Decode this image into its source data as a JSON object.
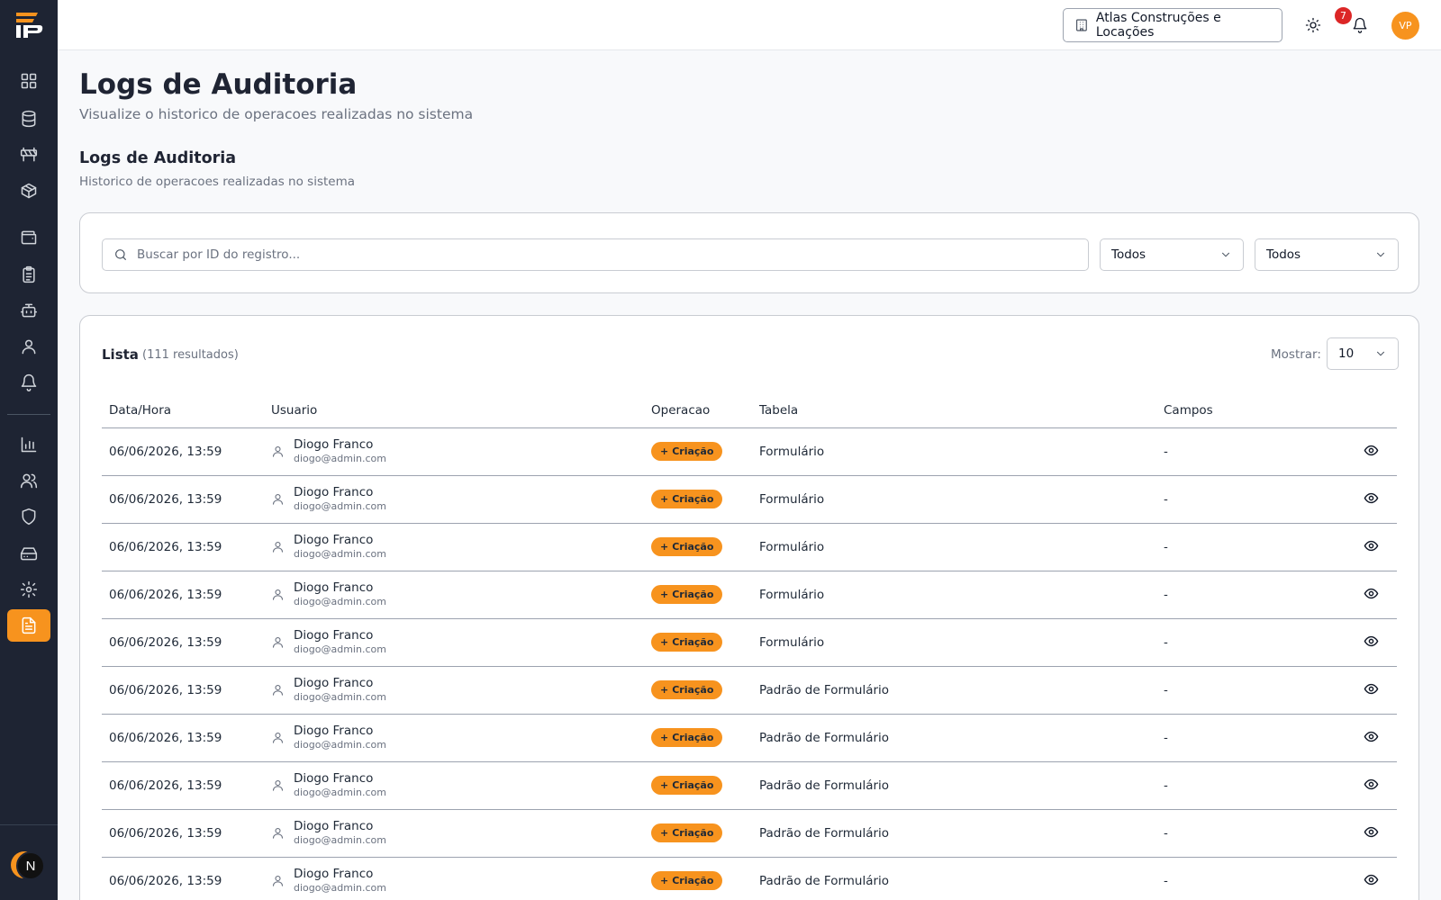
{
  "header": {
    "company": "Atlas Construções e Locações",
    "notifications_count": "7",
    "avatar_initials": "VP"
  },
  "sidebar": {
    "items": [
      {
        "icon": "dashboard-icon"
      },
      {
        "icon": "database-icon"
      },
      {
        "icon": "barrier-icon"
      },
      {
        "icon": "box-icon"
      },
      {
        "icon": "wallet-icon"
      },
      {
        "icon": "clipboard-icon"
      },
      {
        "icon": "bot-icon"
      },
      {
        "icon": "user-icon"
      },
      {
        "icon": "bell-icon"
      },
      {
        "icon": "chart-icon"
      },
      {
        "icon": "users-icon"
      },
      {
        "icon": "shield-icon"
      },
      {
        "icon": "drive-icon"
      },
      {
        "icon": "settings-icon"
      },
      {
        "icon": "file-text-icon",
        "active": true
      }
    ],
    "bottom_badge": "N",
    "active_color": "#f7931e"
  },
  "page": {
    "title": "Logs de Auditoria",
    "subtitle": "Visualize o historico de operacoes realizadas no sistema",
    "section_title": "Logs de Auditoria",
    "section_subtitle": "Historico de operacoes realizadas no sistema"
  },
  "filters": {
    "search_placeholder": "Buscar por ID do registro...",
    "select1": "Todos",
    "select2": "Todos"
  },
  "list": {
    "title": "Lista",
    "count": "(111 resultados)",
    "show_label": "Mostrar:",
    "page_size": "10",
    "columns": [
      "Data/Hora",
      "Usuario",
      "Operacao",
      "Tabela",
      "Campos"
    ],
    "rows": [
      {
        "datetime": "06/06/2026, 13:59",
        "user": "Diogo Franco",
        "email": "diogo@admin.com",
        "operation": "Criação",
        "table": "Formulário",
        "fields": "-"
      },
      {
        "datetime": "06/06/2026, 13:59",
        "user": "Diogo Franco",
        "email": "diogo@admin.com",
        "operation": "Criação",
        "table": "Formulário",
        "fields": "-"
      },
      {
        "datetime": "06/06/2026, 13:59",
        "user": "Diogo Franco",
        "email": "diogo@admin.com",
        "operation": "Criação",
        "table": "Formulário",
        "fields": "-"
      },
      {
        "datetime": "06/06/2026, 13:59",
        "user": "Diogo Franco",
        "email": "diogo@admin.com",
        "operation": "Criação",
        "table": "Formulário",
        "fields": "-"
      },
      {
        "datetime": "06/06/2026, 13:59",
        "user": "Diogo Franco",
        "email": "diogo@admin.com",
        "operation": "Criação",
        "table": "Formulário",
        "fields": "-"
      },
      {
        "datetime": "06/06/2026, 13:59",
        "user": "Diogo Franco",
        "email": "diogo@admin.com",
        "operation": "Criação",
        "table": "Padrão de Formulário",
        "fields": "-"
      },
      {
        "datetime": "06/06/2026, 13:59",
        "user": "Diogo Franco",
        "email": "diogo@admin.com",
        "operation": "Criação",
        "table": "Padrão de Formulário",
        "fields": "-"
      },
      {
        "datetime": "06/06/2026, 13:59",
        "user": "Diogo Franco",
        "email": "diogo@admin.com",
        "operation": "Criação",
        "table": "Padrão de Formulário",
        "fields": "-"
      },
      {
        "datetime": "06/06/2026, 13:59",
        "user": "Diogo Franco",
        "email": "diogo@admin.com",
        "operation": "Criação",
        "table": "Padrão de Formulário",
        "fields": "-"
      },
      {
        "datetime": "06/06/2026, 13:59",
        "user": "Diogo Franco",
        "email": "diogo@admin.com",
        "operation": "Criação",
        "table": "Padrão de Formulário",
        "fields": "-"
      }
    ]
  },
  "colors": {
    "accent": "#f7931e",
    "sidebar_bg": "#1e2433",
    "notification": "#dc2626"
  }
}
